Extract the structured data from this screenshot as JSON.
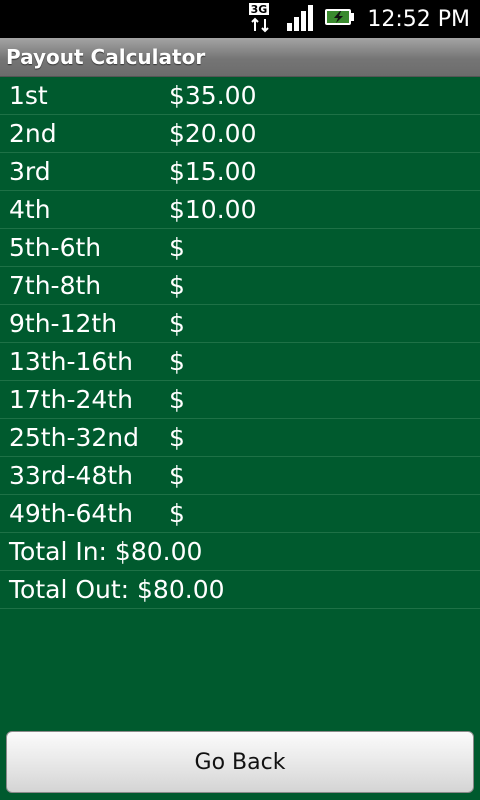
{
  "status_bar": {
    "time": "12:52 PM",
    "network_label": "3G",
    "icons": [
      "3g-data-icon",
      "signal-strength-icon",
      "battery-charging-icon"
    ]
  },
  "app": {
    "title": "Payout Calculator"
  },
  "payouts": [
    {
      "place": "1st",
      "amount": "$35.00"
    },
    {
      "place": "2nd",
      "amount": "$20.00"
    },
    {
      "place": "3rd",
      "amount": "$15.00"
    },
    {
      "place": "4th",
      "amount": "$10.00"
    },
    {
      "place": "5th-6th",
      "amount": "$"
    },
    {
      "place": "7th-8th",
      "amount": "$"
    },
    {
      "place": "9th-12th",
      "amount": "$"
    },
    {
      "place": "13th-16th",
      "amount": "$"
    },
    {
      "place": "17th-24th",
      "amount": "$"
    },
    {
      "place": "25th-32nd",
      "amount": "$"
    },
    {
      "place": "33rd-48th",
      "amount": "$"
    },
    {
      "place": "49th-64th",
      "amount": "$"
    }
  ],
  "totals": {
    "total_in": "Total In: $80.00",
    "total_out": "Total Out: $80.00"
  },
  "buttons": {
    "go_back": "Go Back"
  },
  "colors": {
    "background": "#005a2e",
    "divider": "#1e7146",
    "title_bar": "#757575",
    "text": "#ffffff"
  }
}
